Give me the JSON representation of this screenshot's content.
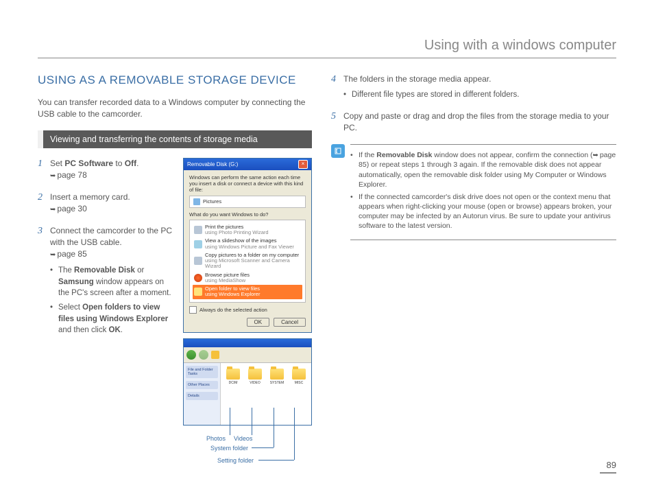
{
  "header": {
    "title": "Using with a windows computer"
  },
  "section": {
    "title": "USING AS A REMOVABLE STORAGE DEVICE",
    "intro": "You can transfer recorded data to a Windows computer by connecting the USB cable to the camcorder.",
    "subheader": "Viewing and transferring the contents of storage media"
  },
  "steps": {
    "s1_a": "Set ",
    "s1_b": "PC Software",
    "s1_c": " to ",
    "s1_d": "Off",
    "s1_e": ".",
    "s1_ref": "page 78",
    "s2": "Insert a memory card.",
    "s2_ref": "page 30",
    "s3": "Connect the camcorder to the PC with the USB cable.",
    "s3_ref": "page 85",
    "s3_bullets": {
      "b1_a": "The ",
      "b1_b": "Removable Disk",
      "b1_c": " or ",
      "b1_d": "Samsung",
      "b1_e": " window appears on the PC's screen after a moment.",
      "b2_a": "Select ",
      "b2_b": "Open folders to view files using Windows Explorer",
      "b2_c": " and then click ",
      "b2_d": "OK",
      "b2_e": "."
    },
    "s4": "The folders in the storage media appear.",
    "s4_bullet": "Different file types are stored in different folders.",
    "s5": "Copy and paste or drag and drop the files from the storage media to your PC."
  },
  "dialog": {
    "title": "Removable Disk (G:)",
    "prompt": "Windows can perform the same action each time you insert a disk or connect a device with this kind of file:",
    "media": "Pictures",
    "question": "What do you want Windows to do?",
    "items": {
      "i1_a": "Print the pictures",
      "i1_b": "using Photo Printing Wizard",
      "i2_a": "View a slideshow of the images",
      "i2_b": "using Windows Picture and Fax Viewer",
      "i3_a": "Copy pictures to a folder on my computer",
      "i3_b": "using Microsoft Scanner and Camera Wizard",
      "i4_a": "Browse picture files",
      "i4_b": "using MediaShow",
      "i5_a": "Open folder to view files",
      "i5_b": "using Windows Explorer"
    },
    "checkbox": "Always do the selected action",
    "ok": "OK",
    "cancel": "Cancel"
  },
  "folders": {
    "f1": "DCIM",
    "f2": "VIDEO",
    "f3": "SYSTEM",
    "f4": "MISC"
  },
  "callouts": {
    "photos": "Photos",
    "videos": "Videos",
    "system": "System folder",
    "setting": "Setting folder"
  },
  "note": {
    "n1_a": "If the ",
    "n1_b": "Removable Disk",
    "n1_c": " window does not appear, confirm the connection (",
    "n1_ref": "page 85",
    "n1_d": ") or repeat steps 1 through 3 again. If the removable disk does not appear automatically, open the removable disk folder using My Computer or Windows Explorer.",
    "n2": "If the connected camcorder's disk drive does not open or the context menu that appears when right-clicking your mouse (open or browse) appears broken, your computer may be infected by an Autorun virus. Be sure to update your antivirus software to the latest version."
  },
  "page_number": "89"
}
